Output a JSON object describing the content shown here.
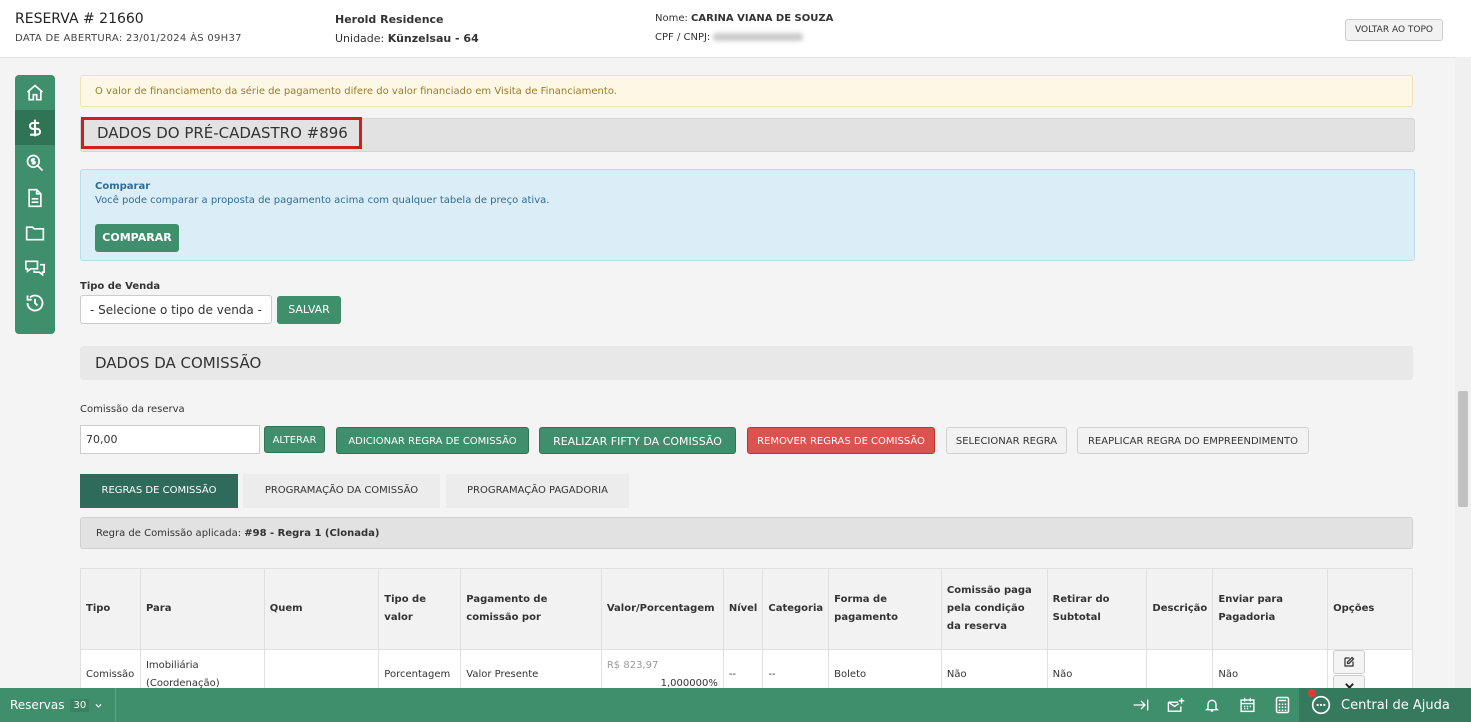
{
  "header": {
    "title": "RESERVA # 21660",
    "abertura": "DATA DE ABERTURA: 23/01/2024 ÀS 09H37",
    "empreendimento": "Herold Residence",
    "unidade_label": "Unidade: ",
    "unidade_value": "Künzelsau - 64",
    "nome_label": "Nome: ",
    "nome_value": "CARINA VIANA DE SOUZA",
    "cpf_label": "CPF / CNPJ: ",
    "voltar_topo": "VOLTAR AO TOPO"
  },
  "sidebar": {
    "items": [
      {
        "icon": "home-icon"
      },
      {
        "icon": "dollar-icon"
      },
      {
        "icon": "search-dollar-icon"
      },
      {
        "icon": "document-icon"
      },
      {
        "icon": "folder-icon"
      },
      {
        "icon": "comments-icon"
      },
      {
        "icon": "history-icon"
      }
    ]
  },
  "alert": "O valor de financiamento da série de pagamento difere do valor financiado em Visita de Financiamento.",
  "precadastro_title": "DADOS DO PRÉ-CADASTRO #896",
  "comparar": {
    "title": "Comparar",
    "text": "Você pode comparar a proposta de pagamento acima com qualquer tabela de preço ativa.",
    "button": "COMPARAR"
  },
  "tipo_venda": {
    "label": "Tipo de Venda",
    "selected": "- Selecione o tipo de venda -",
    "save": "SALVAR"
  },
  "comissao": {
    "section_title": "DADOS DA COMISSÃO",
    "label": "Comissão da reserva",
    "value": "70,00",
    "buttons": {
      "alterar": "ALTERAR",
      "adicionar": "ADICIONAR REGRA DE COMISSÃO",
      "fifty": "REALIZAR FIFTY DA COMISSÃO",
      "remover": "REMOVER REGRAS DE COMISSÃO",
      "selecionar": "SELECIONAR REGRA",
      "reaplicar": "REAPLICAR REGRA DO EMPREENDIMENTO"
    }
  },
  "tabs": [
    "REGRAS DE COMISSÃO",
    "PROGRAMAÇÃO DA COMISSÃO",
    "PROGRAMAÇÃO PAGADORIA"
  ],
  "regra": {
    "label": "Regra de Comissão aplicada: ",
    "value": "#98 - Regra 1 (Clonada)"
  },
  "table": {
    "headers": [
      "Tipo",
      "Para",
      "Quem",
      "Tipo de valor",
      "Pagamento de comissão por",
      "Valor/Porcentagem",
      "Nível",
      "Categoria",
      "Forma de pagamento",
      "Comissão paga pela condição da reserva",
      "Retirar do Subtotal",
      "Descrição",
      "Enviar para Pagadoria",
      "Opções"
    ],
    "rows": [
      {
        "tipo": "Comissão",
        "para": "Imobiliária (Coordenação)",
        "quem": "",
        "tipo_valor": "Porcentagem",
        "pagamento": "Valor Presente",
        "valor": "R$ 823,97",
        "porcentagem": "1,000000%",
        "nivel": "--",
        "categoria": "--",
        "forma": "Boleto",
        "paga_condicao": "Não",
        "retirar": "Não",
        "descricao": "",
        "enviar": "Não"
      }
    ]
  },
  "bottombar": {
    "reservas_label": "Reservas",
    "reservas_count": "30",
    "help": "Central de Ajuda"
  }
}
